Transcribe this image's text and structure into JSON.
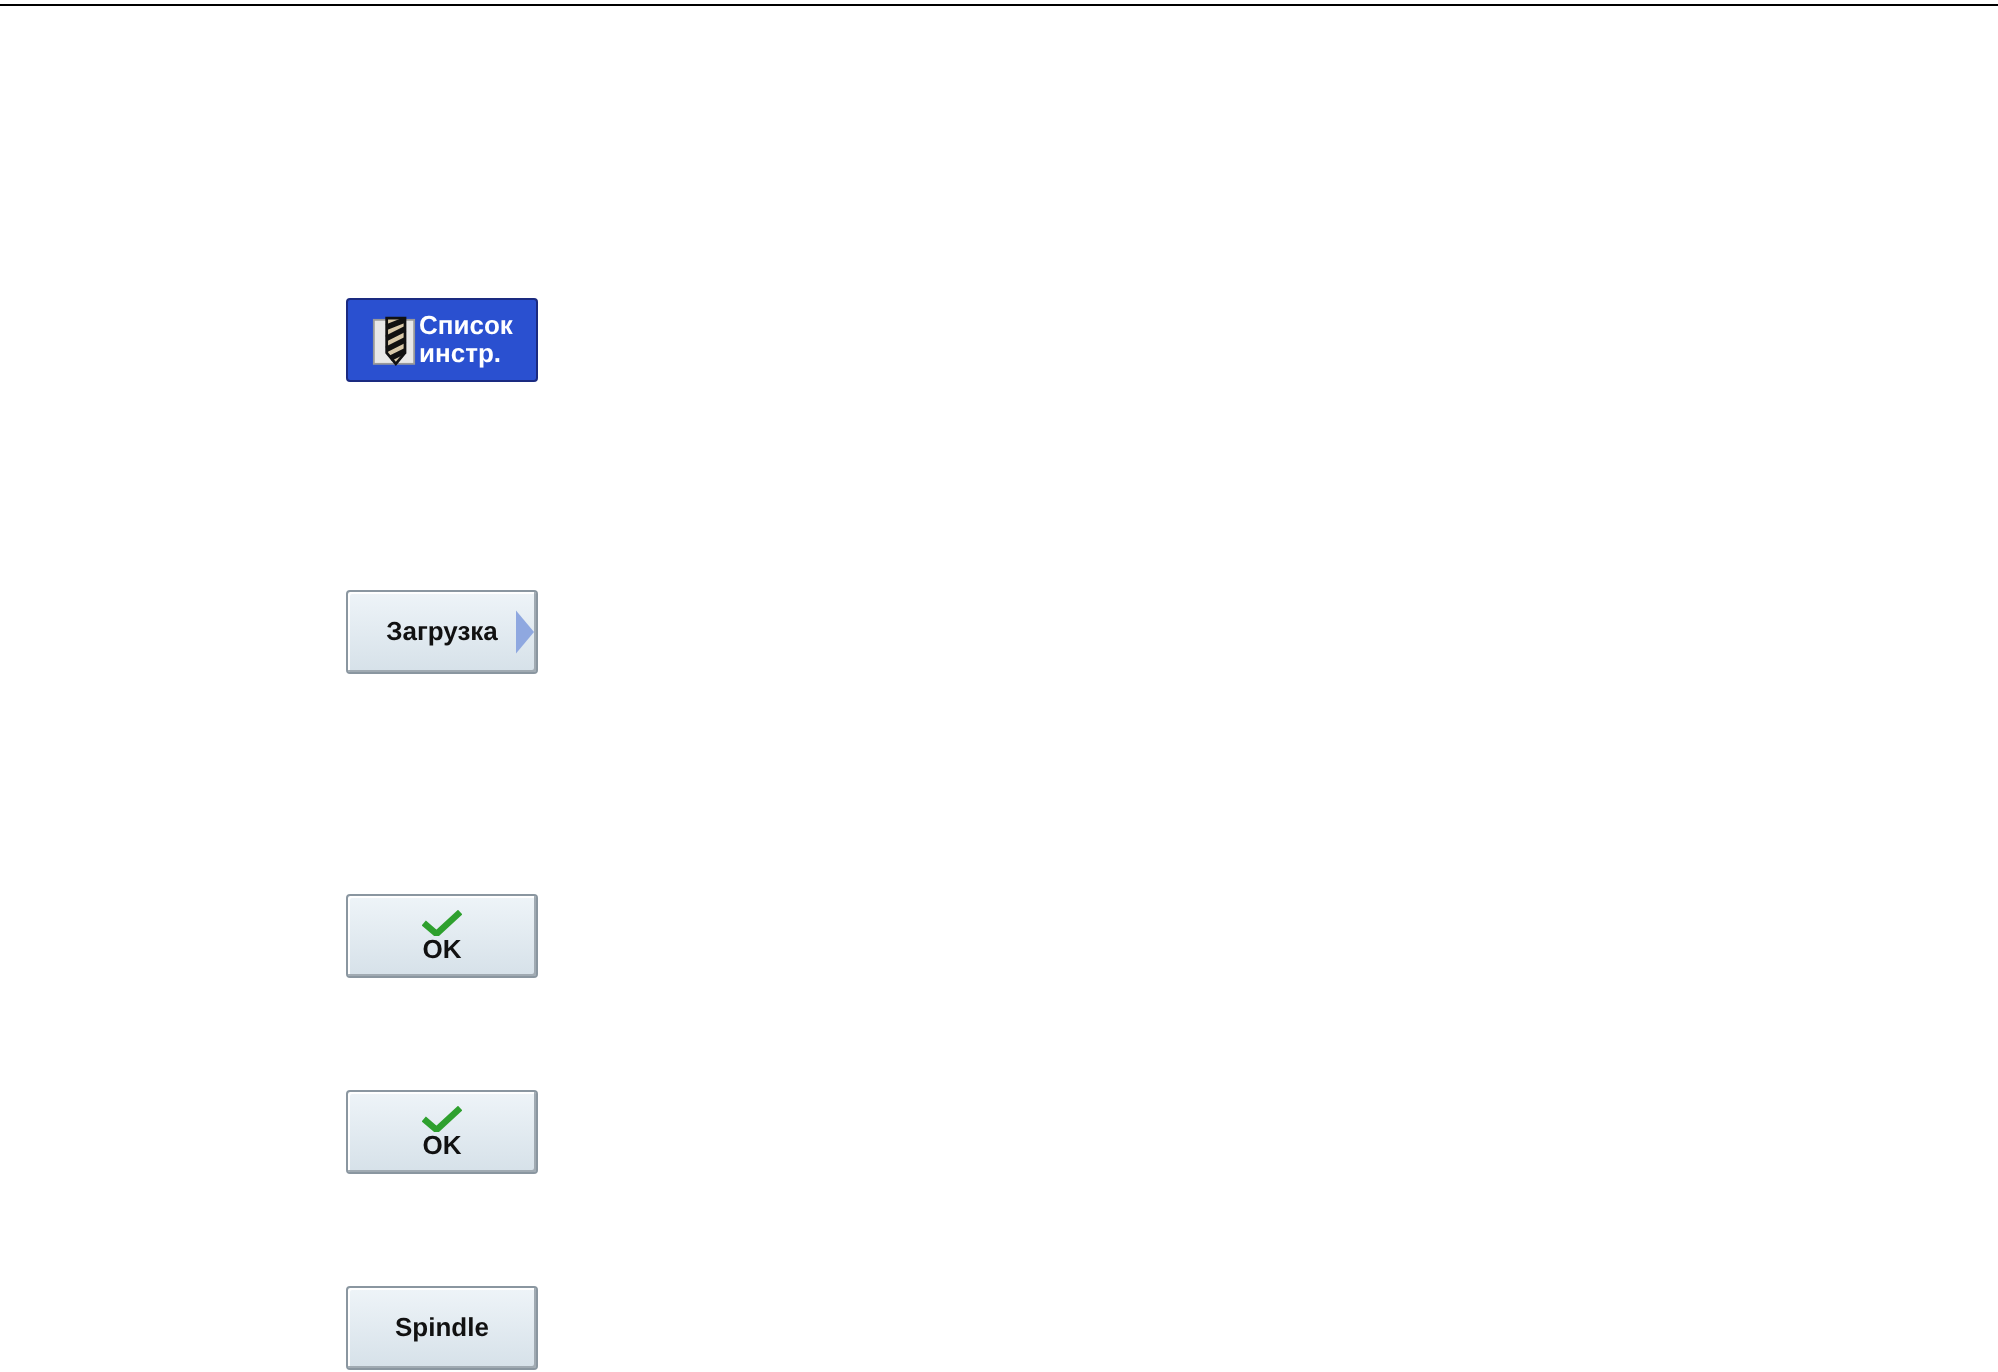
{
  "softkeys": [
    {
      "kind": "tool",
      "lines": [
        "Список",
        "инстр."
      ],
      "selected": true
    },
    {
      "kind": "arrow",
      "lines": [
        "Загрузка"
      ],
      "selected": false
    },
    {
      "kind": "check",
      "lines": [
        "OK"
      ],
      "selected": false
    },
    {
      "kind": "check",
      "lines": [
        "OK"
      ],
      "selected": false
    },
    {
      "kind": "text",
      "lines": [
        "Spindle"
      ],
      "selected": false
    }
  ]
}
